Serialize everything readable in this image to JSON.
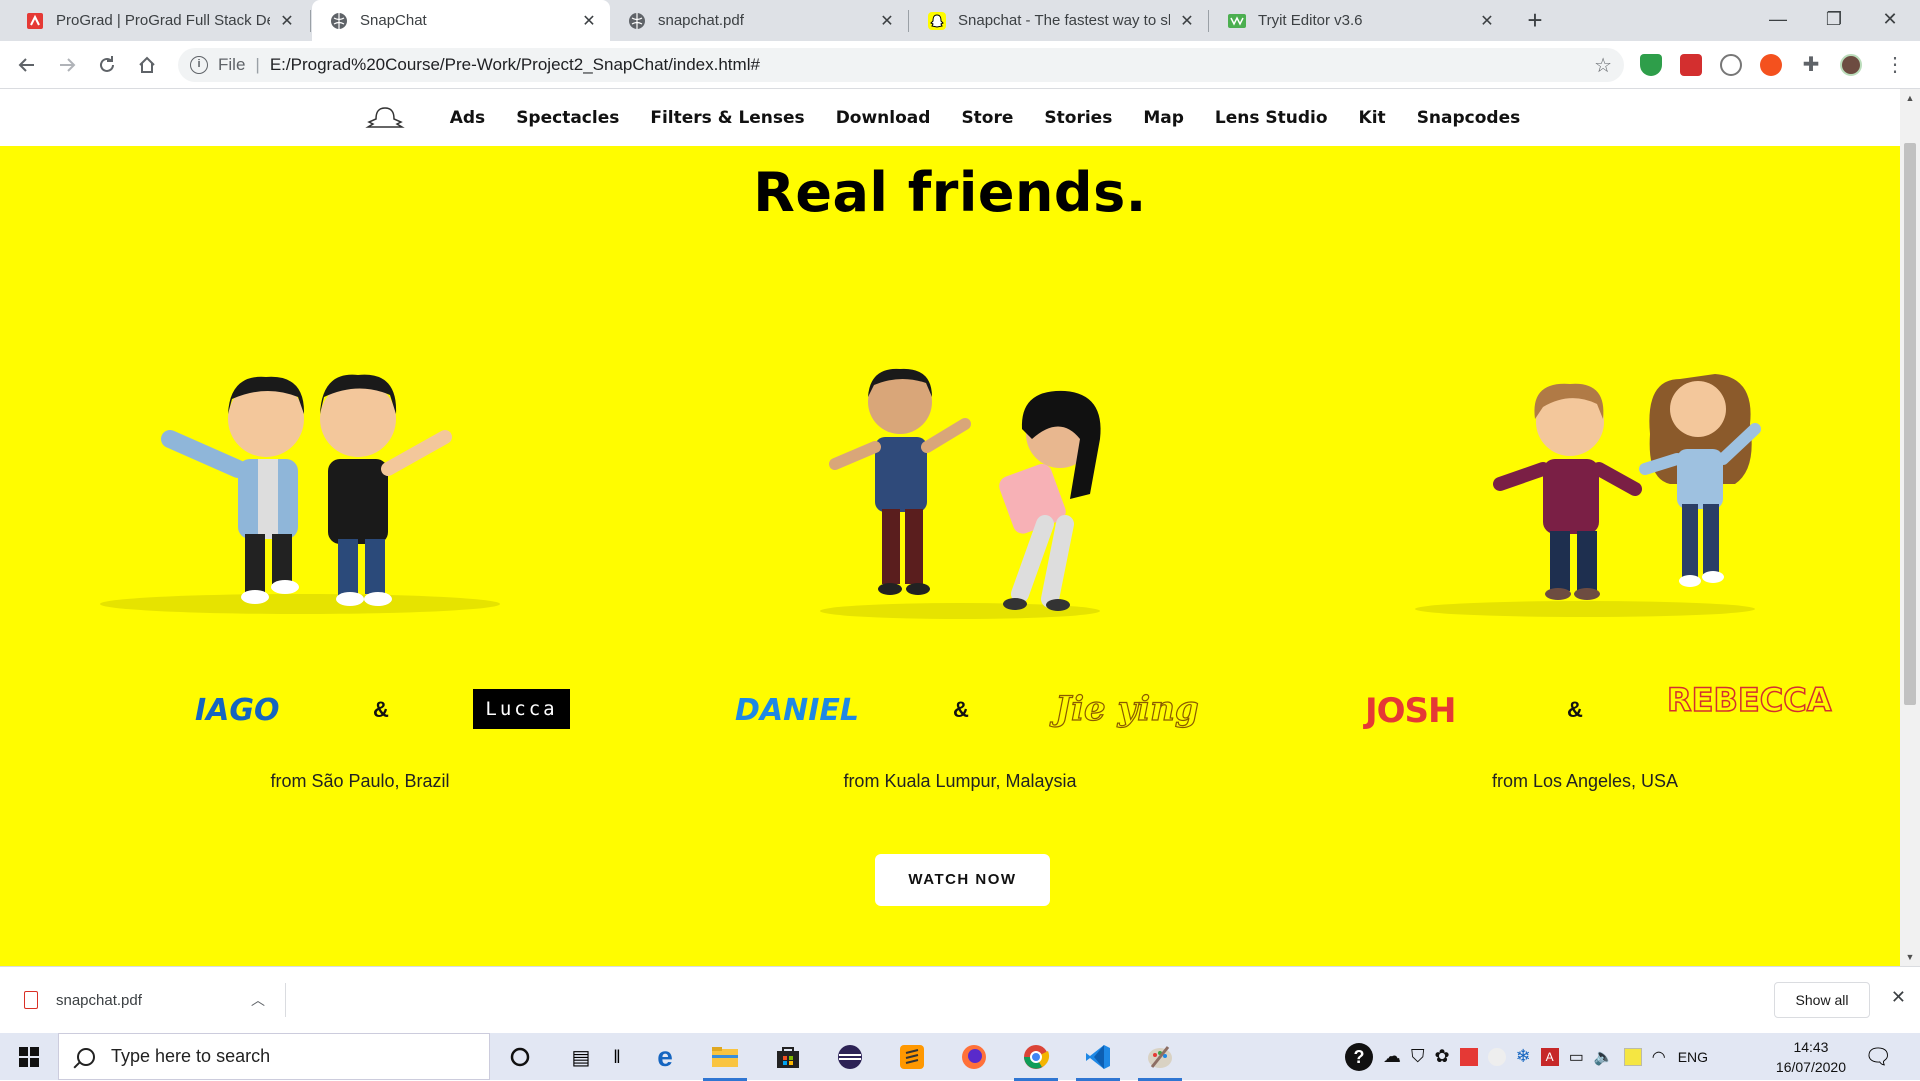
{
  "browser": {
    "tabs": [
      {
        "title": "ProGrad | ProGrad Full Stack Dev",
        "favicon": "prograd-icon",
        "color": "#e53935"
      },
      {
        "title": "SnapChat",
        "favicon": "globe-icon",
        "color": "#5f6368"
      },
      {
        "title": "snapchat.pdf",
        "favicon": "globe-icon",
        "color": "#5f6368"
      },
      {
        "title": "Snapchat - The fastest way to sha",
        "favicon": "snapchat-ghost-icon",
        "color": "#fffc00"
      },
      {
        "title": "Tryit Editor v3.6",
        "favicon": "w3schools-icon",
        "color": "#4caf50"
      }
    ],
    "address": {
      "scheme": "File",
      "url": "E:/Prograd%20Course/Pre-Work/Project2_SnapChat/index.html#"
    }
  },
  "site": {
    "nav": [
      "Ads",
      "Spectacles",
      "Filters & Lenses",
      "Download",
      "Store",
      "Stories",
      "Map",
      "Lens Studio",
      "Kit",
      "Snapcodes"
    ],
    "headline": "Real friends.",
    "groups": [
      {
        "name1": "IAGO",
        "amp": "&",
        "name2": "Lucca",
        "origin": "from São Paulo, Brazil"
      },
      {
        "name1": "DANIEL",
        "amp": "&",
        "name2": "Jie ying",
        "origin": "from Kuala Lumpur, Malaysia"
      },
      {
        "name1": "JOSH",
        "amp": "&",
        "name2": "REBECCA",
        "origin": "from Los Angeles, USA"
      }
    ],
    "cta": "WATCH NOW",
    "background": "#fffc00"
  },
  "downloads": {
    "file": "snapchat.pdf",
    "show_all": "Show all"
  },
  "taskbar": {
    "search_placeholder": "Type here to search",
    "language": "ENG",
    "time": "14:43",
    "date": "16/07/2020"
  }
}
